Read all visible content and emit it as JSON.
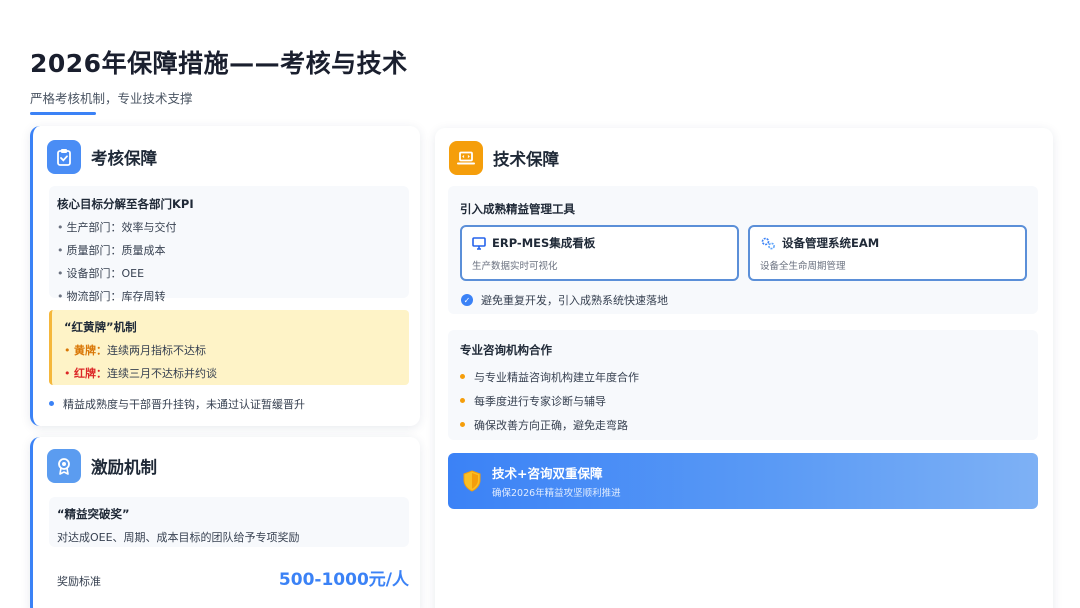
{
  "page": {
    "title": "2026年保障措施——考核与技术",
    "subtitle": "严格考核机制，专业技术支撑"
  },
  "assessment": {
    "title": "考核保障",
    "icon": "clipboard-check-icon",
    "kpi_title": "核心目标分解至各部门KPI",
    "kpi_items": [
      "生产部门：效率与交付",
      "质量部门：质量成本",
      "设备部门：OEE",
      "物流部门：库存周转"
    ],
    "card_title": "“红黄牌”机制",
    "yellow_label": "黄牌：",
    "yellow_text": "连续两月指标不达标",
    "red_label": "红牌：",
    "red_text": "连续三月不达标并约谈",
    "note": "精益成熟度与干部晋升挂钩，未通过认证暂缓晋升"
  },
  "incentive": {
    "title": "激励机制",
    "icon": "award-ribbon-icon",
    "award_name": "“精益突破奖”",
    "award_desc": "对达成OEE、周期、成本目标的团队给予专项奖励",
    "standard_label": "奖励标准",
    "standard_value": "500-1000元/人"
  },
  "tech": {
    "title": "技术保障",
    "icon": "laptop-icon",
    "tools_title": "引入成熟精益管理工具",
    "tools": [
      {
        "name": "ERP-MES集成看板",
        "desc": "生产数据实时可视化",
        "icon": "monitor-icon"
      },
      {
        "name": "设备管理系统EAM",
        "desc": "设备全生命周期管理",
        "icon": "gears-icon"
      }
    ],
    "tools_note": "避免重复开发，引入成熟系统快速落地",
    "consult_title": "专业咨询机构合作",
    "consult_items": [
      "与专业精益咨询机构建立年度合作",
      "每季度进行专家诊断与辅导",
      "确保改善方向正确，避免走弯路"
    ],
    "banner_title": "技术+咨询双重保障",
    "banner_subtitle": "确保2026年精益攻坚顺利推进",
    "banner_icon": "shield-icon"
  },
  "colors": {
    "accent": "#3b82f6",
    "warning_bg": "#fef3c7",
    "yellow_card": "#d97706",
    "red_card": "#dc2626",
    "tech_icon": "#f59e0b"
  }
}
